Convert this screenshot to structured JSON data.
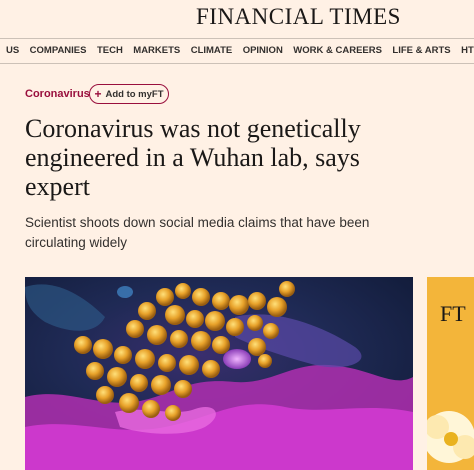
{
  "masthead": {
    "brand": "FINANCIAL TIMES"
  },
  "nav": {
    "items": [
      "US",
      "COMPANIES",
      "TECH",
      "MARKETS",
      "CLIMATE",
      "OPINION",
      "WORK & CAREERS",
      "LIFE & ARTS",
      "HTSI"
    ]
  },
  "article": {
    "topic": "Coronavirus",
    "myft_label": "Add to myFT",
    "headline": "Coronavirus was not genetically engineered in a Wuhan lab, says expert",
    "standfirst": "Scientist shoots down social media claims that have been circulating widely"
  },
  "side_ad": {
    "text": "FT"
  },
  "colors": {
    "background": "#fff1e5",
    "accent": "#990f3d",
    "ad": "#f3b53a"
  }
}
